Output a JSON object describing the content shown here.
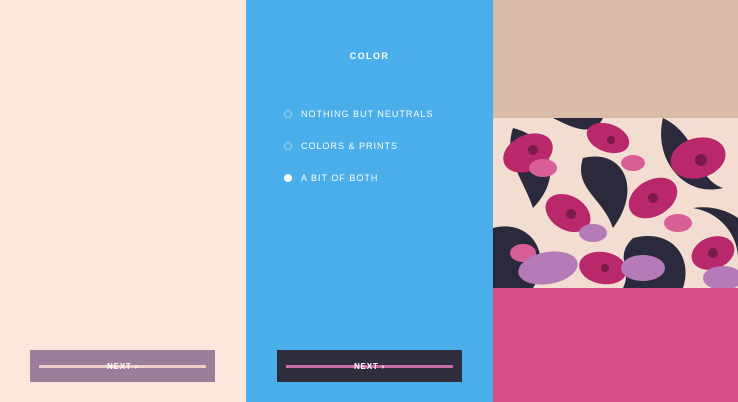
{
  "left_panel": {
    "next_label": "NEXT ›",
    "background": "#fbe7dc",
    "button_color": "#9a7e9b"
  },
  "middle_panel": {
    "title": "COLOR",
    "options": [
      {
        "label": "NOTHING BUT NEUTRALS",
        "selected": false
      },
      {
        "label": "COLORS & PRINTS",
        "selected": false
      },
      {
        "label": "A BIT OF BOTH",
        "selected": true
      }
    ],
    "next_label": "NEXT ›",
    "background": "#4aaeea",
    "button_color": "#2f2e3e"
  },
  "right_panel": {
    "swatches": [
      {
        "name": "neutral-tan",
        "color": "#d9bba8"
      },
      {
        "name": "floral-print",
        "color": "#b8286a"
      },
      {
        "name": "solid-pink",
        "color": "#d64f84"
      }
    ]
  }
}
